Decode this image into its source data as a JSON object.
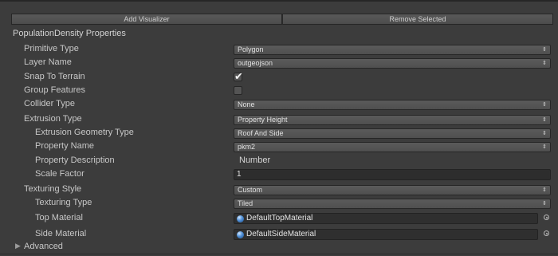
{
  "toolbar": {
    "add_label": "Add Visualizer",
    "remove_label": "Remove Selected"
  },
  "section": {
    "title": "PopulationDensity Properties"
  },
  "fields": {
    "primitive_type": {
      "label": "Primitive Type",
      "value": "Polygon"
    },
    "layer_name": {
      "label": "Layer Name",
      "value": "outgeojson"
    },
    "snap_to_terrain": {
      "label": "Snap To Terrain",
      "checked": true
    },
    "group_features": {
      "label": "Group Features",
      "checked": false
    },
    "collider_type": {
      "label": "Collider Type",
      "value": "None"
    },
    "extrusion_type": {
      "label": "Extrusion Type",
      "value": "Property Height"
    },
    "extrusion_geometry_type": {
      "label": "Extrusion Geometry Type",
      "value": "Roof And Side"
    },
    "property_name": {
      "label": "Property Name",
      "value": "pkm2"
    },
    "property_description": {
      "label": "Property Description",
      "value": "Number"
    },
    "scale_factor": {
      "label": "Scale Factor",
      "value": "1"
    },
    "texturing_style": {
      "label": "Texturing Style",
      "value": "Custom"
    },
    "texturing_type": {
      "label": "Texturing Type",
      "value": "Tiled"
    },
    "top_material": {
      "label": "Top Material",
      "value": "DefaultTopMaterial"
    },
    "side_material": {
      "label": "Side Material",
      "value": "DefaultSideMaterial"
    }
  },
  "advanced": {
    "label": "Advanced",
    "expanded": false
  },
  "icons": {
    "dropdown_arrows": "⇕",
    "checkmark": "✔",
    "foldout": "▶"
  }
}
